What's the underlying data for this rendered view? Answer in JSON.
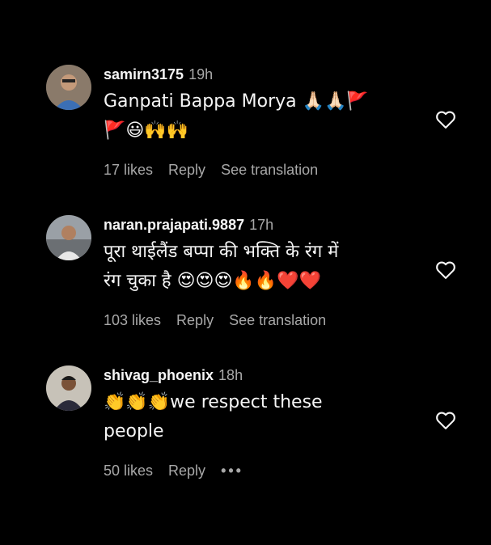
{
  "colors": {
    "background": "#000000",
    "text": "#f5f5f5",
    "muted": "#a8a8a8"
  },
  "comments": [
    {
      "username": "samirn3175",
      "time": "19h",
      "text": "Ganpati Bappa Morya 🙏🏻🙏🏻🚩\n🚩😃🙌🙌",
      "likes": "17 likes",
      "reply": "Reply",
      "translation": "See translation",
      "avatar_icon": "user-avatar-icon",
      "heart_icon": "heart-outline-icon"
    },
    {
      "username": "naran.prajapati.9887",
      "time": "17h",
      "text": "पूरा थाईलैंड बप्पा की भक्ति के रंग में\nरंग चुका है 😍😍😍🔥🔥❤️❤️",
      "likes": "103 likes",
      "reply": "Reply",
      "translation": "See translation",
      "avatar_icon": "user-avatar-icon",
      "heart_icon": "heart-outline-icon"
    },
    {
      "username": "shivag_phoenix",
      "time": "18h",
      "text": "👏👏👏we respect these\npeople",
      "likes": "50 likes",
      "reply": "Reply",
      "more": "•••",
      "avatar_icon": "user-avatar-icon",
      "heart_icon": "heart-outline-icon"
    }
  ]
}
